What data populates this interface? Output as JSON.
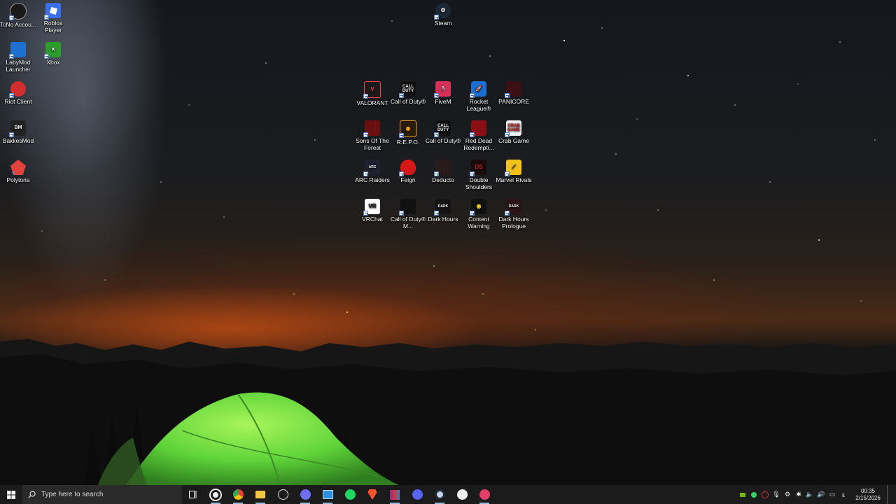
{
  "desktop_icons": {
    "tcno": "TcNo Accou...",
    "roblox": "Roblox Player",
    "steam": "Steam",
    "labymod": "LabyMod Launcher",
    "xbox": "Xbox",
    "riot": "Riot Client",
    "bakkesmod": "BakkesMod",
    "polytoria": "Polytoria",
    "valorant": "VALORANT",
    "cod1": "Call of Duty®",
    "fivem": "FiveM",
    "rocket": "Rocket League®",
    "panicore": "PANICORE",
    "sons": "Sons Of The Forest",
    "repo": "R.E.P.O.",
    "cod2": "Call of Duty®",
    "rdr": "Red Dead Redempti...",
    "crab": "Crab Game",
    "arc": "ARC Raiders",
    "feign": "Feign",
    "deducto": "Deducto",
    "double": "Double Shoulders",
    "marvel": "Marvel Rivals",
    "vrchat": "VRChat",
    "codm": "Call of Duty® M...",
    "darkhours": "Dark Hours",
    "content": "Content Warning",
    "darkprologue": "Dark Hours Prologue"
  },
  "taskbar": {
    "search_placeholder": "Type here to search",
    "time": "00:35",
    "date": "2/15/2026",
    "language": "ε",
    "apps": [
      "task-view-icon",
      "steam-tray-icon",
      "chrome-icon",
      "file-explorer-icon",
      "obs-icon",
      "discord-ptb-icon",
      "window-app-icon",
      "spotify-icon",
      "brave-icon",
      "winrar-icon",
      "discord-icon",
      "steam-icon",
      "epic-icon",
      "rocket-league-icon"
    ]
  },
  "colors": {
    "taskbar_bg": "#1b1b1c",
    "search_bg": "#2a2a2b",
    "tent_green": "#5fd43a"
  }
}
